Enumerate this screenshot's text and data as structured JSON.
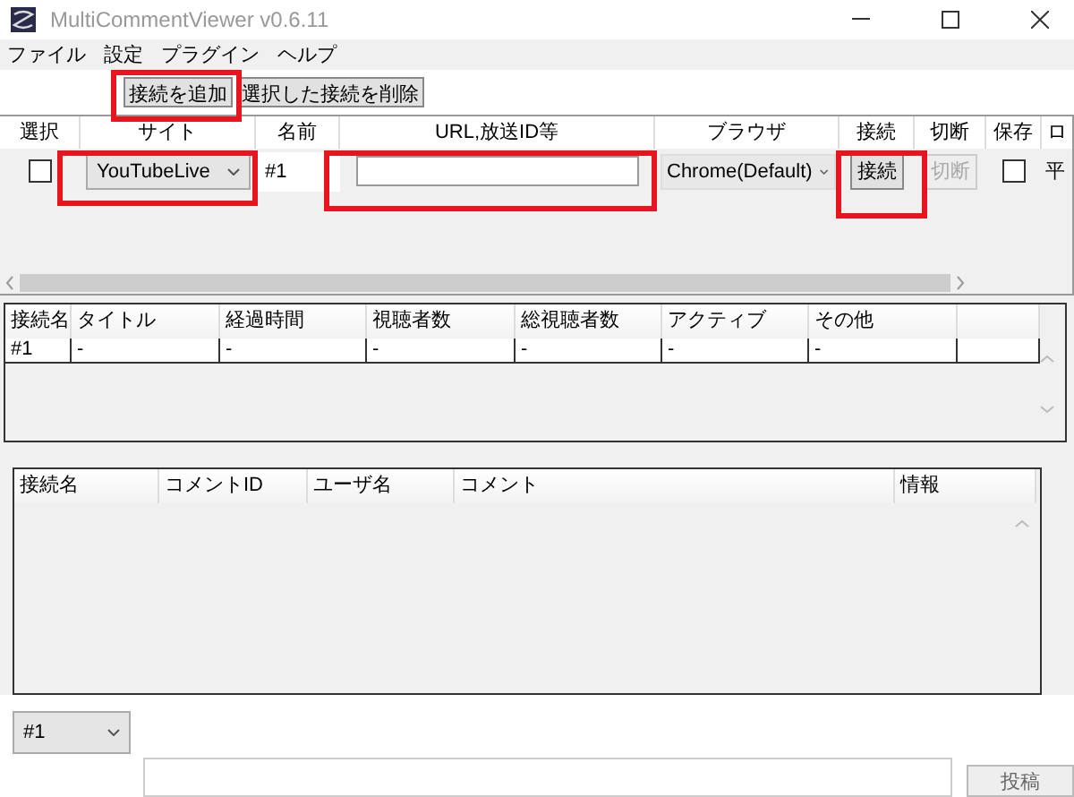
{
  "window": {
    "title": "MultiCommentViewer v0.6.11"
  },
  "menu": [
    "ファイル",
    "設定",
    "プラグイン",
    "ヘルプ"
  ],
  "toolbar": [
    "接続を追加",
    "選択した接続を削除"
  ],
  "connections": {
    "columns": [
      "選択",
      "サイト",
      "名前",
      "URL,放送ID等",
      "ブラウザ",
      "接続",
      "切断",
      "保存",
      "ロ"
    ],
    "rows": [
      {
        "checked": false,
        "site": "YouTubeLive",
        "name": "#1",
        "browser": "Chrome(Default)",
        "connect": {
          "label": "接続",
          "disabled": false
        },
        "disconnect": {
          "label": "切断",
          "disabled": true
        },
        "save": false,
        "column_9": "平"
      }
    ]
  },
  "info": {
    "columns": [
      "接続名",
      "タイトル",
      "経過時間",
      "視聴者数",
      "総視聴者数",
      "アクティブ",
      "その他"
    ],
    "rows": [
      {
        "cells": [
          "#1",
          "-",
          "-",
          "-",
          "-",
          "-",
          "-"
        ]
      }
    ]
  },
  "comments": {
    "columns": [
      "接続名",
      "コメントID",
      "ユーザ名",
      "コメント",
      "情報"
    ]
  },
  "post": {
    "connection": "#1",
    "button": "投稿"
  }
}
